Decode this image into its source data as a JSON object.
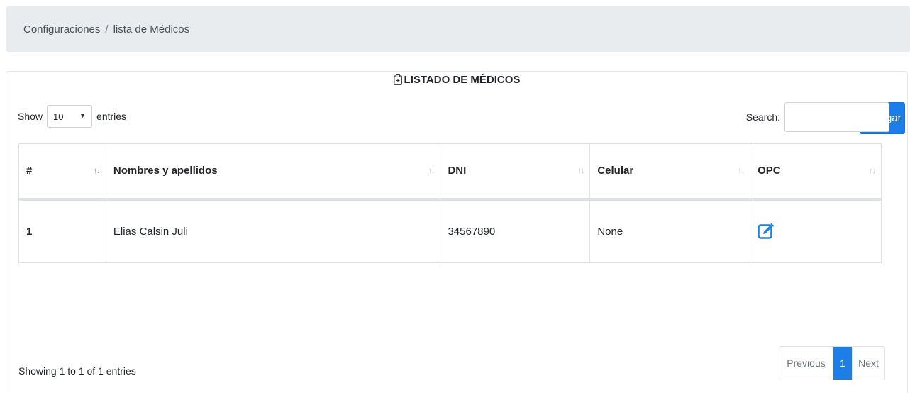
{
  "breadcrumb": {
    "items": [
      "Configuraciones",
      "lista de Médicos"
    ],
    "separator": "/"
  },
  "card": {
    "title": "LISTADO DE MÉDICOS",
    "title_icon": "clipboard-icon",
    "add_button": "Agregar"
  },
  "length": {
    "prefix": "Show",
    "value": "10",
    "suffix": "entries"
  },
  "search": {
    "label": "Search:",
    "value": ""
  },
  "table": {
    "headers": [
      "#",
      "Nombres y apellidos",
      "DNI",
      "Celular",
      "OPC"
    ],
    "rows": [
      {
        "num": "1",
        "nombre": "Elias Calsin Juli",
        "dni": "34567890",
        "celular": "None",
        "opc_icon": "edit-icon"
      }
    ]
  },
  "footer": {
    "info": "Showing 1 to 1 of 1 entries",
    "prev": "Previous",
    "current": "1",
    "next": "Next"
  },
  "colors": {
    "primary": "#1e7ee8",
    "breadcrumb_bg": "#e9ecef",
    "border": "#dee2e6"
  }
}
